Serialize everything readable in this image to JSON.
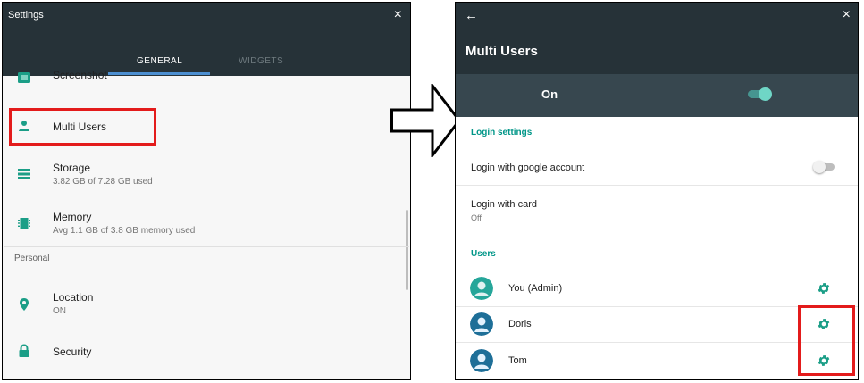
{
  "left": {
    "title": "Settings",
    "close": "×",
    "tabs": [
      {
        "label": "GENERAL",
        "active": true
      },
      {
        "label": "WIDGETS",
        "active": false
      }
    ],
    "items": [
      {
        "title": "Screenshot",
        "subtitle": "",
        "icon": "screenshot-icon"
      },
      {
        "title": "Multi Users",
        "subtitle": "",
        "icon": "person-icon"
      },
      {
        "title": "Storage",
        "subtitle": "3.82 GB of 7.28 GB used",
        "icon": "storage-icon"
      },
      {
        "title": "Memory",
        "subtitle": "Avg 1.1 GB of 3.8 GB memory used",
        "icon": "memory-icon"
      }
    ],
    "section": "Personal",
    "personal_items": [
      {
        "title": "Location",
        "subtitle": "ON",
        "icon": "location-icon"
      },
      {
        "title": "Security",
        "subtitle": "",
        "icon": "lock-icon"
      }
    ]
  },
  "right": {
    "back": "←",
    "close": "×",
    "title": "Multi Users",
    "master_switch": {
      "label": "On",
      "enabled": true
    },
    "login_section": "Login settings",
    "login_google": {
      "label": "Login with google account",
      "enabled": false
    },
    "login_card": {
      "label": "Login with card",
      "value": "Off"
    },
    "users_section": "Users",
    "users": [
      {
        "name": "You (Admin)",
        "avatar_color": "#26a69a"
      },
      {
        "name": "Doris",
        "avatar_color": "#1e6f98"
      },
      {
        "name": "Tom",
        "avatar_color": "#1e6f98"
      }
    ]
  },
  "colors": {
    "header": "#263238",
    "switch_bar": "#37474f",
    "accent": "#009688",
    "icon": "#1b9e87",
    "highlight": "#e31b1b",
    "tab_underline": "#4c8fd1"
  }
}
